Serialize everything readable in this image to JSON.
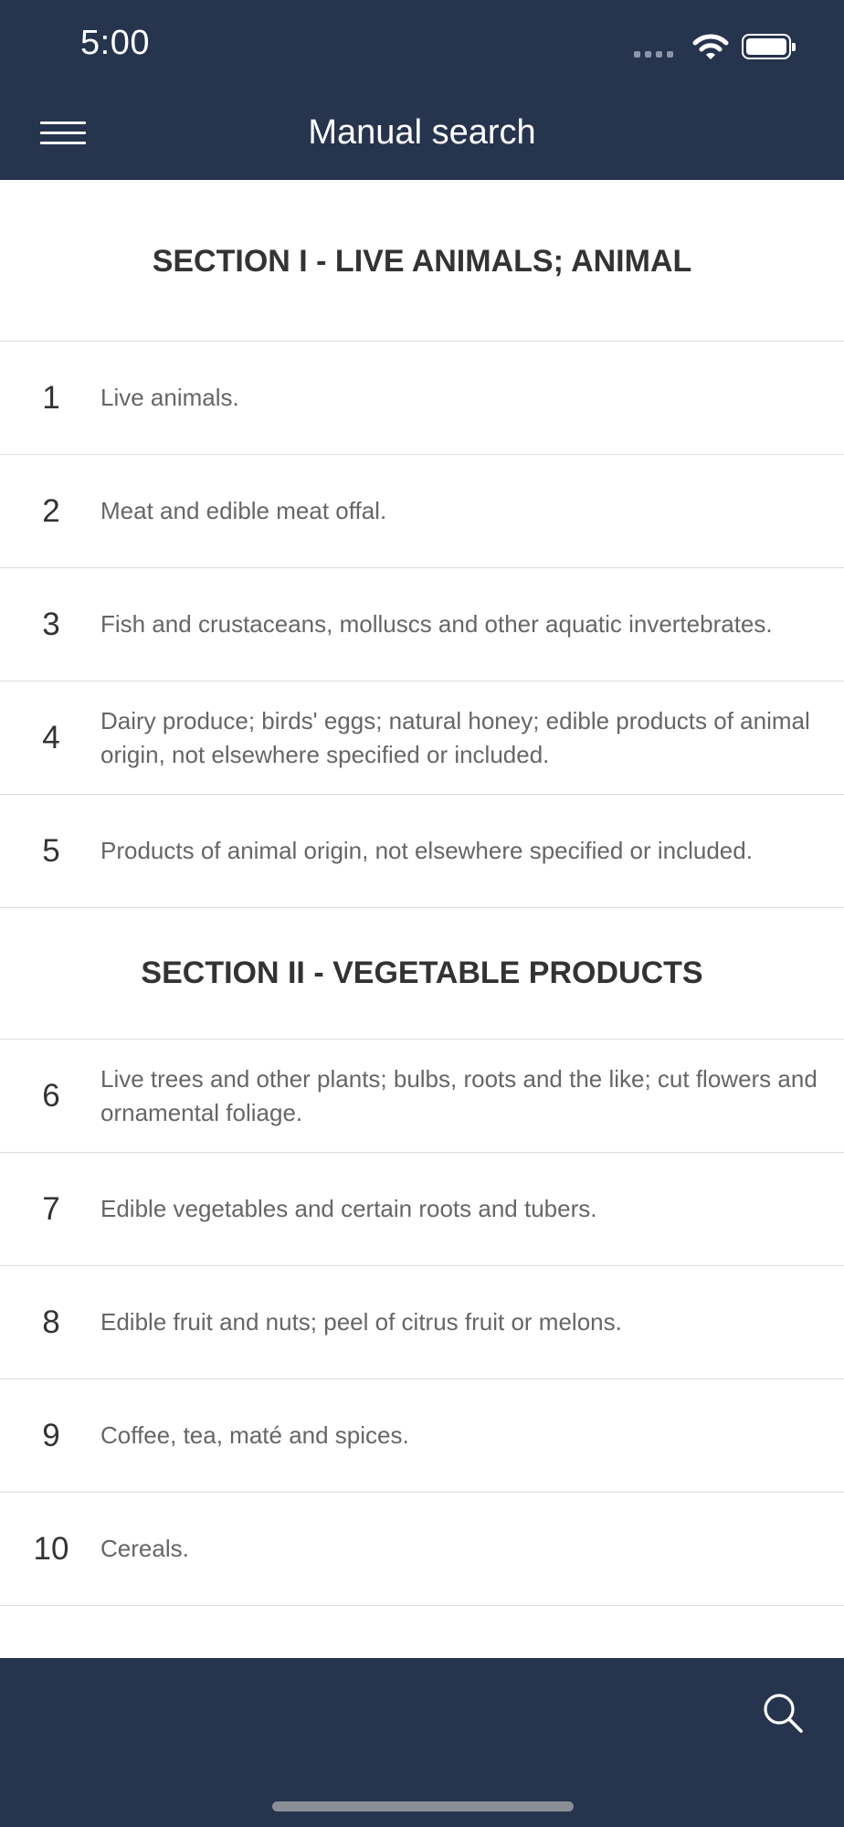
{
  "status_bar": {
    "time": "5:00"
  },
  "header": {
    "title": "Manual search",
    "menu_icon": "hamburger-menu-icon"
  },
  "sections": [
    {
      "title": "SECTION I - LIVE ANIMALS; ANIMAL"
    },
    {
      "title": "SECTION II - VEGETABLE PRODUCTS"
    }
  ],
  "chapters": [
    {
      "number": "1",
      "text": "Live animals."
    },
    {
      "number": "2",
      "text": "Meat and edible meat offal."
    },
    {
      "number": "3",
      "text": "Fish and crustaceans, molluscs and other aquatic invertebrates."
    },
    {
      "number": "4",
      "text": "Dairy produce; birds' eggs; natural honey; edible products of animal origin, not elsewhere specified or included."
    },
    {
      "number": "5",
      "text": "Products of animal origin, not elsewhere specified or included."
    },
    {
      "number": "6",
      "text": "Live trees and other plants; bulbs, roots and the like; cut flowers and ornamental foliage."
    },
    {
      "number": "7",
      "text": "Edible vegetables and certain roots and tubers."
    },
    {
      "number": "8",
      "text": "Edible fruit and nuts; peel of citrus fruit or melons."
    },
    {
      "number": "9",
      "text": "Coffee, tea, maté and spices."
    },
    {
      "number": "10",
      "text": "Cereals."
    }
  ],
  "bottom_bar": {
    "search_icon": "search-icon"
  },
  "colors": {
    "bar_background": "#26344e",
    "divider": "#dcdcdc",
    "number_text": "#333333",
    "body_text": "#666666"
  }
}
